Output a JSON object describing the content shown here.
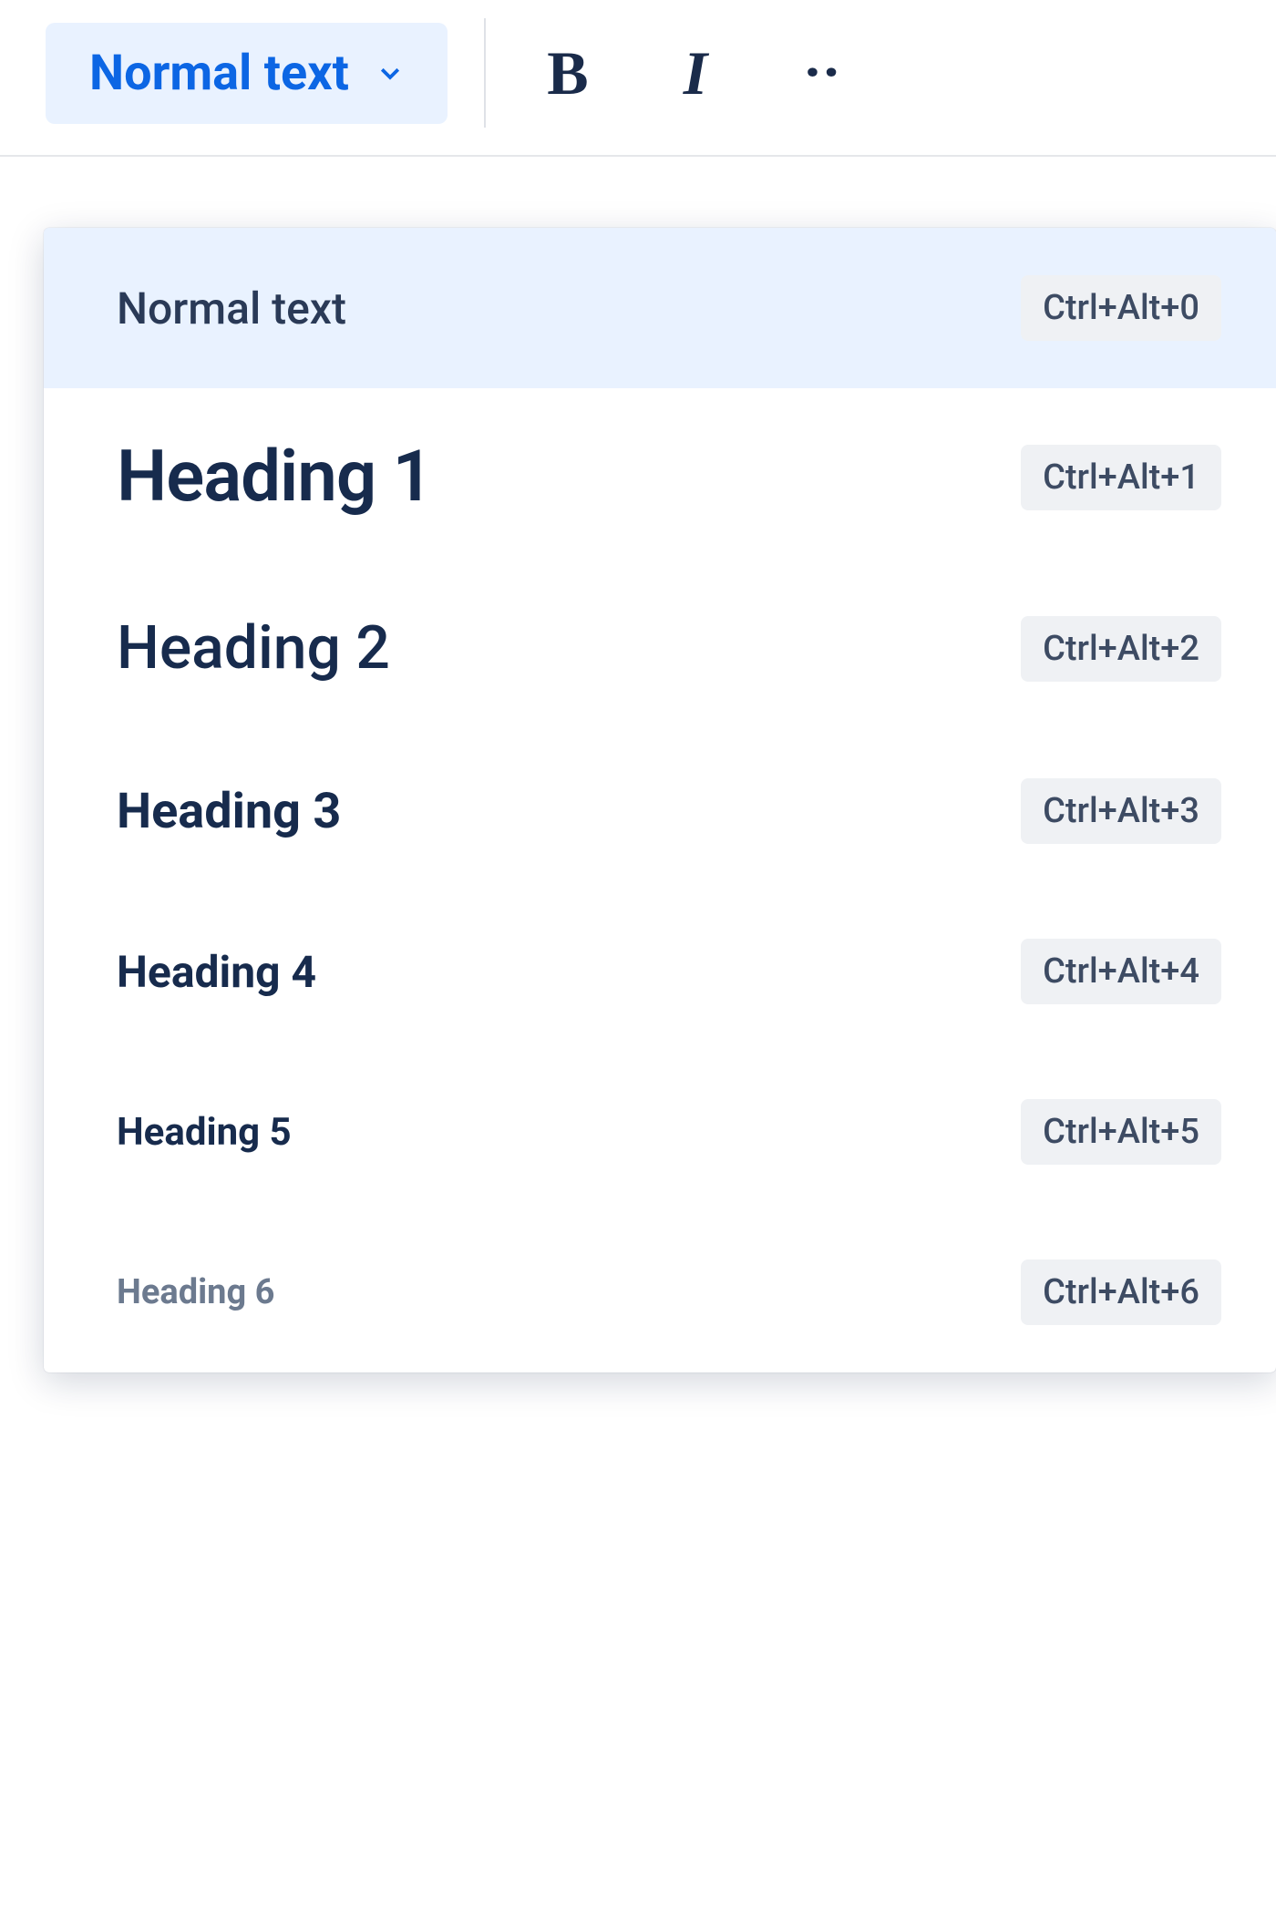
{
  "toolbar": {
    "style_dropdown": {
      "selected_label": "Normal text"
    },
    "bold_label": "B",
    "italic_label": "I",
    "more_label": "··"
  },
  "text_styles_menu": {
    "items": [
      {
        "label": "Normal text",
        "shortcut": "Ctrl+Alt+0",
        "style_class": "lbl-normal",
        "selected": true
      },
      {
        "label": "Heading 1",
        "shortcut": "Ctrl+Alt+1",
        "style_class": "lbl-h1",
        "selected": false
      },
      {
        "label": "Heading 2",
        "shortcut": "Ctrl+Alt+2",
        "style_class": "lbl-h2",
        "selected": false
      },
      {
        "label": "Heading 3",
        "shortcut": "Ctrl+Alt+3",
        "style_class": "lbl-h3",
        "selected": false
      },
      {
        "label": "Heading 4",
        "shortcut": "Ctrl+Alt+4",
        "style_class": "lbl-h4",
        "selected": false
      },
      {
        "label": "Heading 5",
        "shortcut": "Ctrl+Alt+5",
        "style_class": "lbl-h5",
        "selected": false
      },
      {
        "label": "Heading 6",
        "shortcut": "Ctrl+Alt+6",
        "style_class": "lbl-h6",
        "selected": false
      }
    ]
  }
}
